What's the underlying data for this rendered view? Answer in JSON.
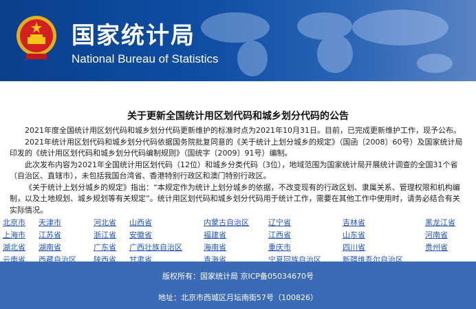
{
  "header": {
    "title_cn": "国家统计局",
    "title_en": "National Bureau of Statistics",
    "emblem_icon": "national-emblem-icon",
    "map_icon": "world-map-icon",
    "colors": {
      "banner": "#0f4fa4",
      "footer": "#3b6bb7",
      "link": "#2054c2"
    }
  },
  "notice": {
    "title": "关于更新全国统计用区划代码和城乡划分代码的公告",
    "paragraphs": [
      "2021年度全国统计用区划代码和城乡划分代码更新维护的标准时点为2021年10月31日。目前，已完成更新维护工作，现予公布。",
      "2021年统计用区划代码和城乡划分代码依据国务院批复同意的《关于统计上划分城乡的规定》（国函〔2008〕60号）及国家统计局印发的《统计用区划代码和城乡划分代码编制规则》（国统字〔2009〕91号）编制。",
      "此次发布内容为2021年全国统计用区划代码（12位）和城乡分类代码（3位），地域范围为国家统计局开展统计调查的全国31个省（自治区、直辖市），未包括我国台湾省、香港特别行政区和澳门特别行政区。",
      "《关于统计上划分城乡的规定》指出：“本规定作为统计上划分城乡的依据，不改变现有的行政区划、隶属关系、管理权限和机构编制，以及土地规划、城乡规划等有关规定”。统计用区划代码和城乡划分代码用于统计工作，需要在其他工作中使用时，请务必结合有关实际情况。"
    ]
  },
  "provinces": [
    [
      "北京市",
      "天津市",
      "河北省",
      "山西省",
      "内蒙古自治区",
      "辽宁省",
      "吉林省",
      "黑龙江省"
    ],
    [
      "上海市",
      "江苏省",
      "浙江省",
      "安徽省",
      "福建省",
      "江西省",
      "山东省",
      "河南省"
    ],
    [
      "湖北省",
      "湖南省",
      "广东省",
      "广西壮族自治区",
      "海南省",
      "重庆市",
      "四川省",
      "贵州省"
    ],
    [
      "云南省",
      "西藏自治区",
      "陕西省",
      "甘肃省",
      "青海省",
      "宁夏回族自治区",
      "新疆维吾尔自治区",
      ""
    ]
  ],
  "footer": {
    "line1": "版权所有：国家统计局 京ICP备05034670号",
    "line2": "地址：北京市西城区月坛南街57号（100826）"
  }
}
